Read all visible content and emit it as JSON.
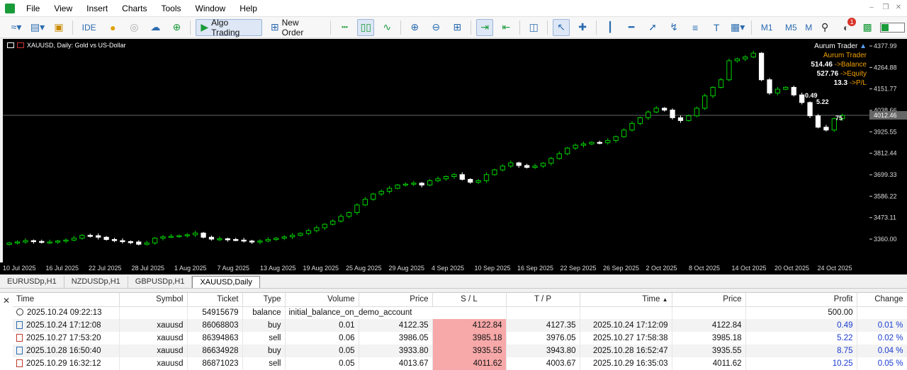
{
  "menu": [
    "File",
    "View",
    "Insert",
    "Charts",
    "Tools",
    "Window",
    "Help"
  ],
  "toolbar": {
    "ide": "IDE",
    "algo_trading": "Algo Trading",
    "new_order": "New Order",
    "timeframes": [
      "M1",
      "M5",
      "M"
    ]
  },
  "notification_count": "1",
  "chart": {
    "symbol_title": "XAUUSD, Daily:  Gold vs US-Dollar",
    "trader_name": "Aurum Trader",
    "trader_name2": "Aurum Trader",
    "balance": "514.46",
    "balance_label": "->Balance",
    "equity": "527.76",
    "equity_label": "->Equity",
    "pl": "13.3",
    "pl_label": "->P/L",
    "annot1": "0.49",
    "annot2": "5.22",
    "annot3": "75",
    "current_price": "4012.46",
    "price_ticks": [
      "4377.99",
      "4264.88",
      "4151.77",
      "4038.66",
      "3925.55",
      "3812.44",
      "3699.33",
      "3586.22",
      "3473.11",
      "3360.00"
    ],
    "time_ticks": [
      "10 Jul 2025",
      "16 Jul 2025",
      "22 Jul 2025",
      "28 Jul 2025",
      "1 Aug 2025",
      "7 Aug 2025",
      "13 Aug 2025",
      "19 Aug 2025",
      "25 Aug 2025",
      "29 Aug 2025",
      "4 Sep 2025",
      "10 Sep 2025",
      "16 Sep 2025",
      "22 Sep 2025",
      "26 Sep 2025",
      "2 Oct 2025",
      "8 Oct 2025",
      "14 Oct 2025",
      "20 Oct 2025",
      "24 Oct 2025"
    ],
    "colors": {
      "up": "#00d000",
      "down": "#ffffff",
      "bg": "#000000"
    }
  },
  "chart_tabs": [
    "EURUSDp,H1",
    "NZDUSDp,H1",
    "GBPUSDp,H1",
    "XAUUSD,Daily"
  ],
  "trade_table": {
    "headers": [
      "Time",
      "Symbol",
      "Ticket",
      "Type",
      "Volume",
      "Price",
      "S / L",
      "T / P",
      "Time",
      "Price",
      "Profit",
      "Change"
    ],
    "balance_row": {
      "time": "2025.10.24 09:22:13",
      "ticket": "54915679",
      "type": "balance",
      "comment": "initial_balance_on_demo_account",
      "profit": "500.00"
    },
    "rows": [
      {
        "time": "2025.10.24 17:12:08",
        "symbol": "xauusd",
        "ticket": "86068803",
        "type": "buy",
        "volume": "0.01",
        "price": "4122.35",
        "sl": "4122.84",
        "tp": "4127.35",
        "close_time": "2025.10.24 17:12:09",
        "close_price": "4122.84",
        "profit": "0.49",
        "change": "0.01 %"
      },
      {
        "time": "2025.10.27 17:53:20",
        "symbol": "xauusd",
        "ticket": "86394863",
        "type": "sell",
        "volume": "0.06",
        "price": "3986.05",
        "sl": "3985.18",
        "tp": "3976.05",
        "close_time": "2025.10.27 17:58:38",
        "close_price": "3985.18",
        "profit": "5.22",
        "change": "0.02 %"
      },
      {
        "time": "2025.10.28 16:50:40",
        "symbol": "xauusd",
        "ticket": "86634928",
        "type": "buy",
        "volume": "0.05",
        "price": "3933.80",
        "sl": "3935.55",
        "tp": "3943.80",
        "close_time": "2025.10.28 16:52:47",
        "close_price": "3935.55",
        "profit": "8.75",
        "change": "0.04 %"
      },
      {
        "time": "2025.10.29 16:32:12",
        "symbol": "xauusd",
        "ticket": "86871023",
        "type": "sell",
        "volume": "0.05",
        "price": "4013.67",
        "sl": "4011.62",
        "tp": "4003.67",
        "close_time": "2025.10.29 16:35:03",
        "close_price": "4011.62",
        "profit": "10.25",
        "change": "0.05 %"
      }
    ]
  }
}
